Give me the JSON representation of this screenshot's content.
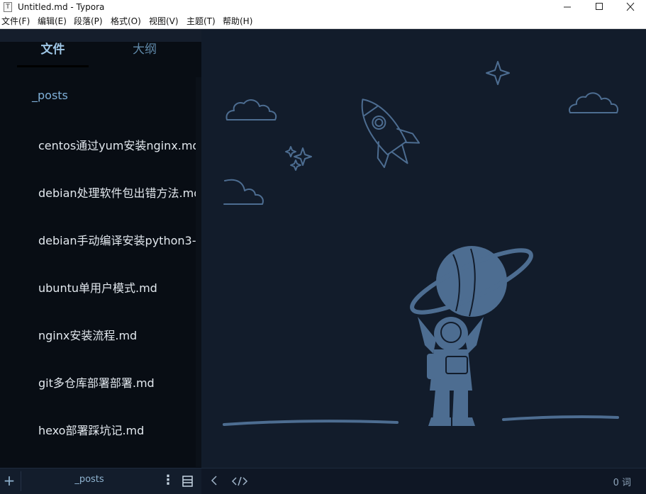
{
  "window": {
    "title": "Untitled.md - Typora",
    "app_icon": "T"
  },
  "menu": [
    "文件(F)",
    "编辑(E)",
    "段落(P)",
    "格式(O)",
    "视图(V)",
    "主题(T)",
    "帮助(H)"
  ],
  "sidebar": {
    "tab_files": "文件",
    "tab_outline": "大纲",
    "folder": "_posts",
    "files": [
      "centos通过yum安装nginx.md",
      "debian处理软件包出错方法.md",
      "debian手动编译安装python3-",
      "ubuntu单用户模式.md",
      "nginx安装流程.md",
      "git多仓库部署部署.md",
      "hexo部署踩坑记.md"
    ]
  },
  "bottombar": {
    "plus": "+",
    "folder": "_posts",
    "more": "⋮",
    "word_count": "0 词"
  },
  "icons": {
    "min": "minimize-icon",
    "max": "maximize-icon",
    "close": "close-icon",
    "layout": "panel-layout-icon",
    "back": "chevron-left-icon",
    "code": "source-code-icon"
  },
  "colors": {
    "editor_bg": "#121c2b",
    "sidebar_bg": "#080d14",
    "illustration": "#4d6d91",
    "accent": "#9ec6e6"
  }
}
